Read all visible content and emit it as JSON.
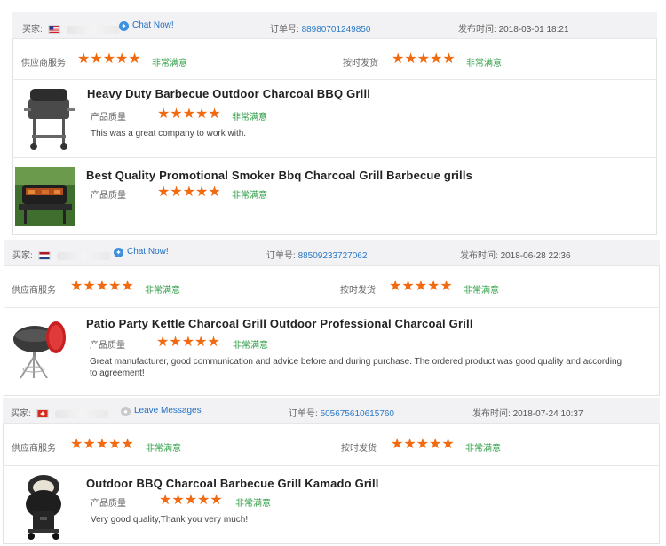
{
  "labels": {
    "buyer": "买家:",
    "order_no": "订单号:",
    "published": "发布时间:",
    "supplier_service": "供应商服务",
    "on_time_shipping": "按时发货",
    "product_quality": "产品质量",
    "very_satisfied": "非常满意",
    "stars": "★★★★★"
  },
  "reviews": [
    {
      "buyer_flag": "us-flag-icon",
      "contact_label": "Chat Now!",
      "order_number": "88980701249850",
      "publish_time": "2018-03-01 18:21",
      "supplier_rating": 5,
      "shipping_rating": 5,
      "products": [
        {
          "title": "Heavy Duty Barbecue Outdoor Charcoal BBQ Grill",
          "quality_rating": 5,
          "comment": "This was a great company to work with."
        },
        {
          "title": "Best Quality Promotional Smoker Bbq Charcoal Grill Barbecue grills",
          "quality_rating": 5,
          "comment": ""
        }
      ]
    },
    {
      "buyer_flag": "nl-flag-icon",
      "contact_label": "Chat Now!",
      "order_number": "88509233727062",
      "publish_time": "2018-06-28 22:36",
      "supplier_rating": 5,
      "shipping_rating": 5,
      "products": [
        {
          "title": "Patio Party Kettle Charcoal Grill Outdoor Professional Charcoal Grill",
          "quality_rating": 5,
          "comment": "Great manufacturer, good communication and advice before and during purchase. The ordered product was good quality and according to agreement!"
        }
      ]
    },
    {
      "buyer_flag": "ch-flag-icon",
      "contact_label": "Leave Messages",
      "order_number": "505675610615760",
      "publish_time": "2018-07-24 10:37",
      "supplier_rating": 5,
      "shipping_rating": 5,
      "products": [
        {
          "title": "Outdoor BBQ Charcoal Barbecue Grill Kamado Grill",
          "quality_rating": 5,
          "comment": "Very good quality,Thank you very much!"
        }
      ]
    }
  ],
  "colors": {
    "star": "#f26a10",
    "satisfied": "#2e9e45",
    "link": "#2a79c6",
    "header_bg": "#f2f2f4"
  }
}
